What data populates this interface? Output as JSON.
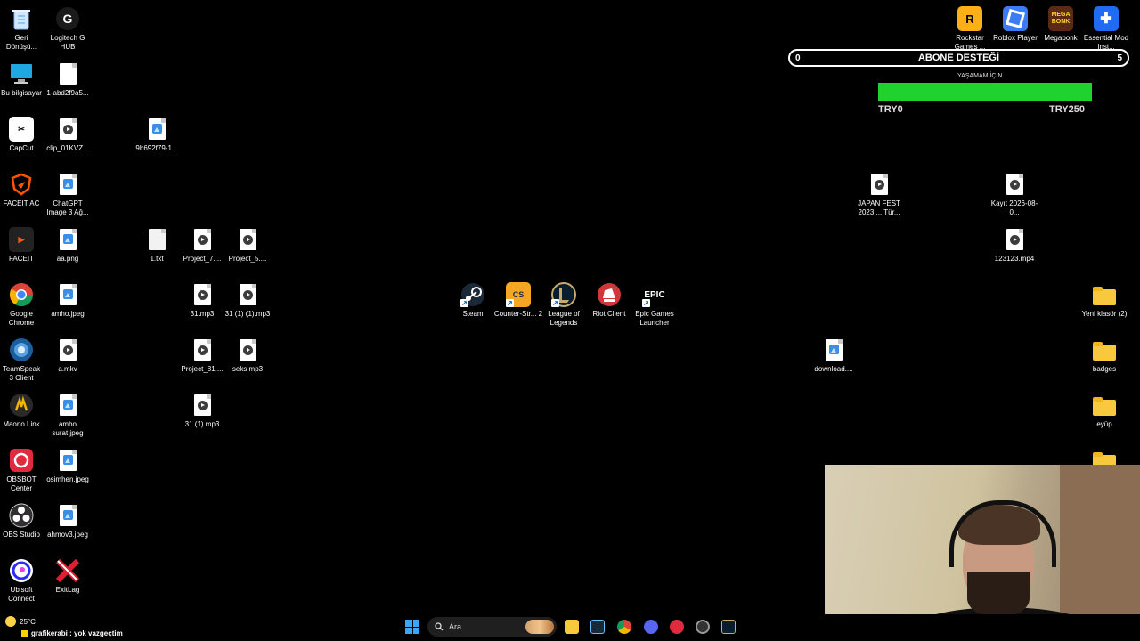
{
  "desktop_icons": {
    "col1": [
      {
        "label": "Geri Dönüşü...",
        "icon": "recycle-bin-icon"
      },
      {
        "label": "Bu bilgisayar",
        "icon": "computer-icon"
      },
      {
        "label": "CapCut",
        "icon": "capcut-icon"
      },
      {
        "label": "FACEIT AC",
        "icon": "faceit-ac-icon"
      },
      {
        "label": "FACEIT",
        "icon": "faceit-icon"
      },
      {
        "label": "Google Chrome",
        "icon": "chrome-icon"
      },
      {
        "label": "TeamSpeak 3 Client",
        "icon": "teamspeak-icon"
      },
      {
        "label": "Maono Link",
        "icon": "maono-icon"
      },
      {
        "label": "OBSBOT Center",
        "icon": "obsbot-icon"
      },
      {
        "label": "OBS Studio",
        "icon": "obs-icon"
      },
      {
        "label": "Ubisoft Connect",
        "icon": "ubisoft-icon"
      }
    ],
    "col2": [
      {
        "label": "Logitech G HUB",
        "icon": "logitech-icon"
      },
      {
        "label": "1-abd2f9a5...",
        "icon": "file-icon"
      },
      {
        "label": "clip_01KVZ...",
        "icon": "video-file-icon"
      },
      {
        "label": "ChatGPT Image 3 Ağ...",
        "icon": "image-file-icon"
      },
      {
        "label": "aa.png",
        "icon": "image-file-icon"
      },
      {
        "label": "amho.jpeg",
        "icon": "image-file-icon"
      },
      {
        "label": "a.mkv",
        "icon": "video-file-icon"
      },
      {
        "label": "amho surat.jpeg",
        "icon": "image-file-icon"
      },
      {
        "label": "osimhen.jpeg",
        "icon": "image-file-icon"
      },
      {
        "label": "ahmov3.jpeg",
        "icon": "image-file-icon"
      },
      {
        "label": "ExitLag",
        "icon": "exitlag-icon"
      }
    ],
    "misc_files": [
      {
        "label": "9b692f79-1...",
        "icon": "image-file-icon"
      },
      {
        "label": "1.txt",
        "icon": "text-file-icon"
      },
      {
        "label": "Project_7....",
        "icon": "video-file-icon"
      },
      {
        "label": "Project_5....",
        "icon": "video-file-icon"
      },
      {
        "label": "31.mp3",
        "icon": "audio-file-icon"
      },
      {
        "label": "31 (1) (1).mp3",
        "icon": "audio-file-icon"
      },
      {
        "label": "Project_81....",
        "icon": "video-file-icon"
      },
      {
        "label": "seks.mp3",
        "icon": "audio-file-icon"
      },
      {
        "label": "31 (1).mp3",
        "icon": "audio-file-icon"
      }
    ],
    "games": [
      {
        "label": "Steam",
        "icon": "steam-icon"
      },
      {
        "label": "Counter-Str... 2",
        "icon": "cs2-icon"
      },
      {
        "label": "League of Legends",
        "icon": "lol-icon"
      },
      {
        "label": "Riot Client",
        "icon": "riot-icon"
      },
      {
        "label": "Epic Games Launcher",
        "icon": "epic-icon"
      }
    ],
    "top_right": [
      {
        "label": "Rockstar Games ...",
        "icon": "rockstar-icon"
      },
      {
        "label": "Roblox Player",
        "icon": "roblox-icon"
      },
      {
        "label": "Megabonk",
        "icon": "megabonk-icon"
      },
      {
        "label": "Essential Mod Inst...",
        "icon": "essential-icon"
      }
    ],
    "right_files": [
      {
        "label": "JAPAN FEST 2023 ... Tür...",
        "icon": "video-file-icon"
      },
      {
        "label": "Kayıt 2026-08-0...",
        "icon": "video-file-icon"
      },
      {
        "label": "123123.mp4",
        "icon": "video-file-icon"
      },
      {
        "label": "download....",
        "icon": "image-file-icon"
      }
    ],
    "folders": [
      {
        "label": "Yeni klasör (2)",
        "icon": "folder-icon"
      },
      {
        "label": "badges",
        "icon": "folder-icon"
      },
      {
        "label": "eyüp",
        "icon": "folder-icon"
      },
      {
        "label": "",
        "icon": "folder-icon"
      }
    ]
  },
  "overlay": {
    "subscriber_goal": {
      "title": "ABONE DESTEĞİ",
      "current": "0",
      "target": "5"
    },
    "donation": {
      "label": "YAŞAMAM İÇİN",
      "min": "TRY0",
      "max": "TRY250",
      "progress": 1.0
    }
  },
  "taskbar": {
    "weather": "25°C",
    "chat_message": "grafikerabi : yok vazgeçtim",
    "search_placeholder": "Ara",
    "pinned": [
      "file-explorer-icon",
      "steam-icon",
      "chrome-icon",
      "discord-icon",
      "obsbot-icon",
      "app-icon",
      "lol-icon"
    ]
  },
  "colors": {
    "goal_fill": "#1fd22d",
    "folder": "#f8c93c",
    "start": "#3aa6f5"
  }
}
